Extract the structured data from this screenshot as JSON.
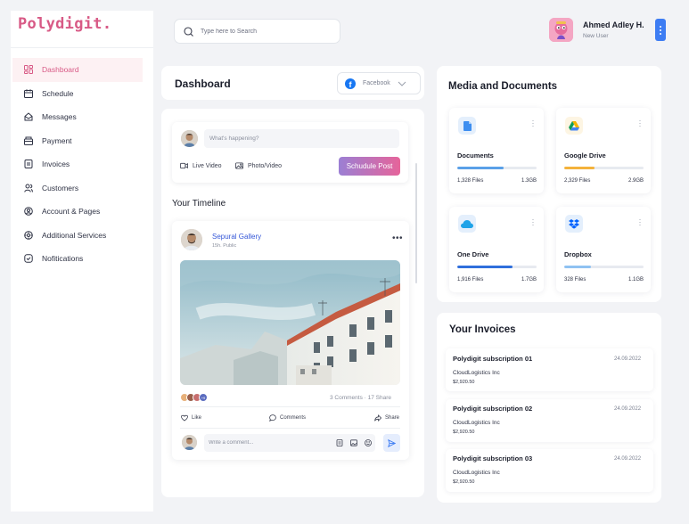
{
  "app": {
    "logo": "Polydigit",
    "logo_dot": "."
  },
  "sidebar": {
    "items": [
      {
        "label": "Dashboard",
        "icon": "dashboard-icon",
        "active": true
      },
      {
        "label": "Schedule",
        "icon": "schedule-icon"
      },
      {
        "label": "Messages",
        "icon": "messages-icon"
      },
      {
        "label": "Payment",
        "icon": "payment-icon"
      },
      {
        "label": "Invoices",
        "icon": "invoices-icon"
      },
      {
        "label": "Customers",
        "icon": "customers-icon"
      },
      {
        "label": "Account & Pages",
        "icon": "account-icon"
      },
      {
        "label": "Additional Services",
        "icon": "services-icon"
      },
      {
        "label": "Nofitications",
        "icon": "notifications-icon"
      }
    ]
  },
  "header": {
    "search_placeholder": "Type here to Search",
    "user": {
      "name": "Ahmed Adley H.",
      "role": "New User"
    }
  },
  "dashboard": {
    "title": "Dashboard",
    "platform_select": "Facebook"
  },
  "composer": {
    "placeholder": "What's happening?",
    "live_video": "Live Video",
    "photo_video": "Photo/Video",
    "post_button": "Schudule Post"
  },
  "timeline": {
    "title": "Your Timeline",
    "post": {
      "author": "Sepural Gallery",
      "meta": "15h. Public",
      "react_more": "+9",
      "comments": "3 Comments",
      "shares": "17 Share",
      "like": "Like",
      "comments_action": "Comments",
      "share": "Share",
      "comment_placeholder": "Write a comment..."
    }
  },
  "media": {
    "title": "Media and Documents",
    "items": [
      {
        "name": "Documents",
        "files": "1,328 Files",
        "size": "1.3GB",
        "progress": 0.58,
        "color": "#5aa0e8",
        "icon": "document-icon"
      },
      {
        "name": "Google Drive",
        "files": "2,329 Files",
        "size": "2.9GB",
        "progress": 0.38,
        "color": "#f4b23b",
        "icon": "google-drive-icon"
      },
      {
        "name": "One Drive",
        "files": "1,916 Files",
        "size": "1.7GB",
        "progress": 0.7,
        "color": "#2f6fdc",
        "icon": "onedrive-icon"
      },
      {
        "name": "Dropbox",
        "files": "328 Files",
        "size": "1.1GB",
        "progress": 0.34,
        "color": "#8fc2f2",
        "icon": "dropbox-icon"
      }
    ]
  },
  "invoices": {
    "title": "Your Invoices",
    "items": [
      {
        "name": "Polydigit subscription 01",
        "date": "24.09.2022",
        "company": "CloudLogistics Inc",
        "amount": "$2,920.50"
      },
      {
        "name": "Polydigit subscription 02",
        "date": "24.09.2022",
        "company": "CloudLogistics Inc",
        "amount": "$2,920.50"
      },
      {
        "name": "Polydigit subscription 03",
        "date": "24.09.2022",
        "company": "CloudLogistics Inc",
        "amount": "$2,920.50"
      }
    ]
  }
}
